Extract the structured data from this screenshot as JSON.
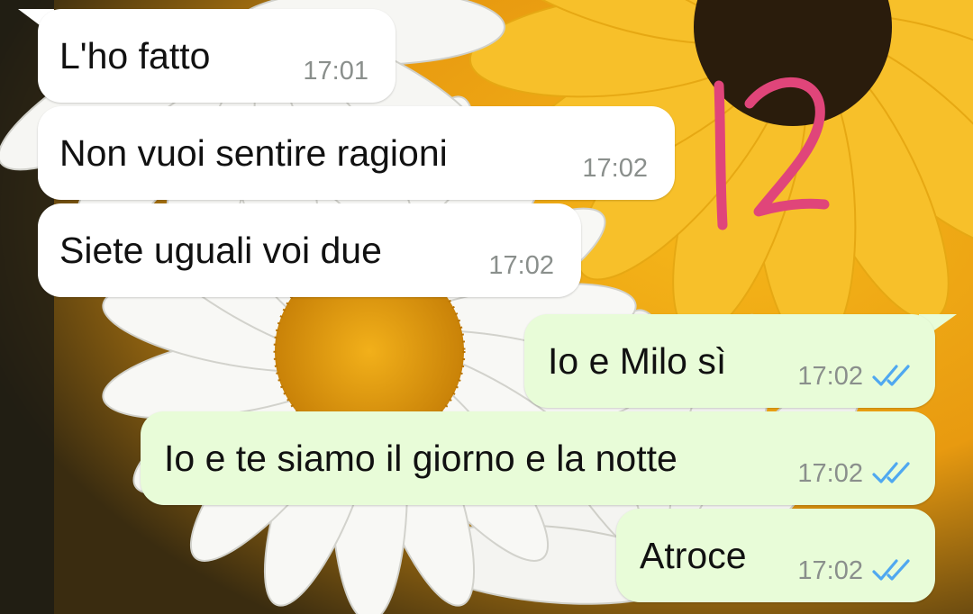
{
  "chat": {
    "messages": [
      {
        "direction": "incoming",
        "text": "L'ho fatto",
        "time": "17:01"
      },
      {
        "direction": "incoming",
        "text": "Non vuoi sentire ragioni",
        "time": "17:02"
      },
      {
        "direction": "incoming",
        "text": "Siete uguali voi due",
        "time": "17:02"
      },
      {
        "direction": "outgoing",
        "text": "Io e Milo sì",
        "time": "17:02",
        "status": "read"
      },
      {
        "direction": "outgoing",
        "text": "Io e te siamo il giorno e la notte",
        "time": "17:02",
        "status": "read"
      },
      {
        "direction": "outgoing",
        "text": "Atroce",
        "time": "17:02",
        "status": "read"
      }
    ]
  },
  "annotation": {
    "text": "12",
    "color": "#e0457a"
  },
  "colors": {
    "incoming_bubble": "#ffffff",
    "outgoing_bubble": "#e8fcd8",
    "read_ticks": "#4fa8f0"
  },
  "icons": {
    "read_receipt": "double-check-icon"
  }
}
